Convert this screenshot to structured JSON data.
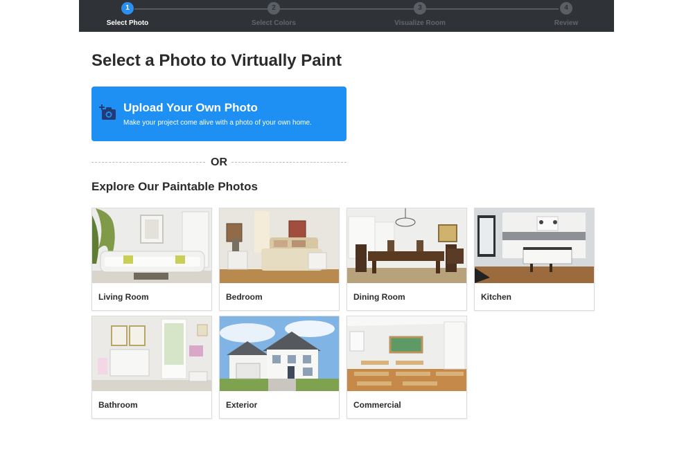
{
  "stepper": {
    "steps": [
      {
        "number": "1",
        "label": "Select Photo",
        "active": true
      },
      {
        "number": "2",
        "label": "Select Colors",
        "active": false
      },
      {
        "number": "3",
        "label": "Visualize Room",
        "active": false
      },
      {
        "number": "4",
        "label": "Review",
        "active": false
      }
    ]
  },
  "page": {
    "title": "Select a Photo to Virtually Paint"
  },
  "upload": {
    "title": "Upload Your Own Photo",
    "subtitle": "Make your project come alive with a photo of your own home.",
    "icon": "add-camera-icon"
  },
  "divider": {
    "text": "OR"
  },
  "explore": {
    "title": "Explore Our Paintable Photos",
    "photos": [
      {
        "label": "Living Room"
      },
      {
        "label": "Bedroom"
      },
      {
        "label": "Dining Room"
      },
      {
        "label": "Kitchen"
      },
      {
        "label": "Bathroom"
      },
      {
        "label": "Exterior"
      },
      {
        "label": "Commercial"
      }
    ]
  },
  "colors": {
    "stepper_bg": "#2f3237",
    "accent": "#1f90f3",
    "text": "#2b2b2b"
  }
}
